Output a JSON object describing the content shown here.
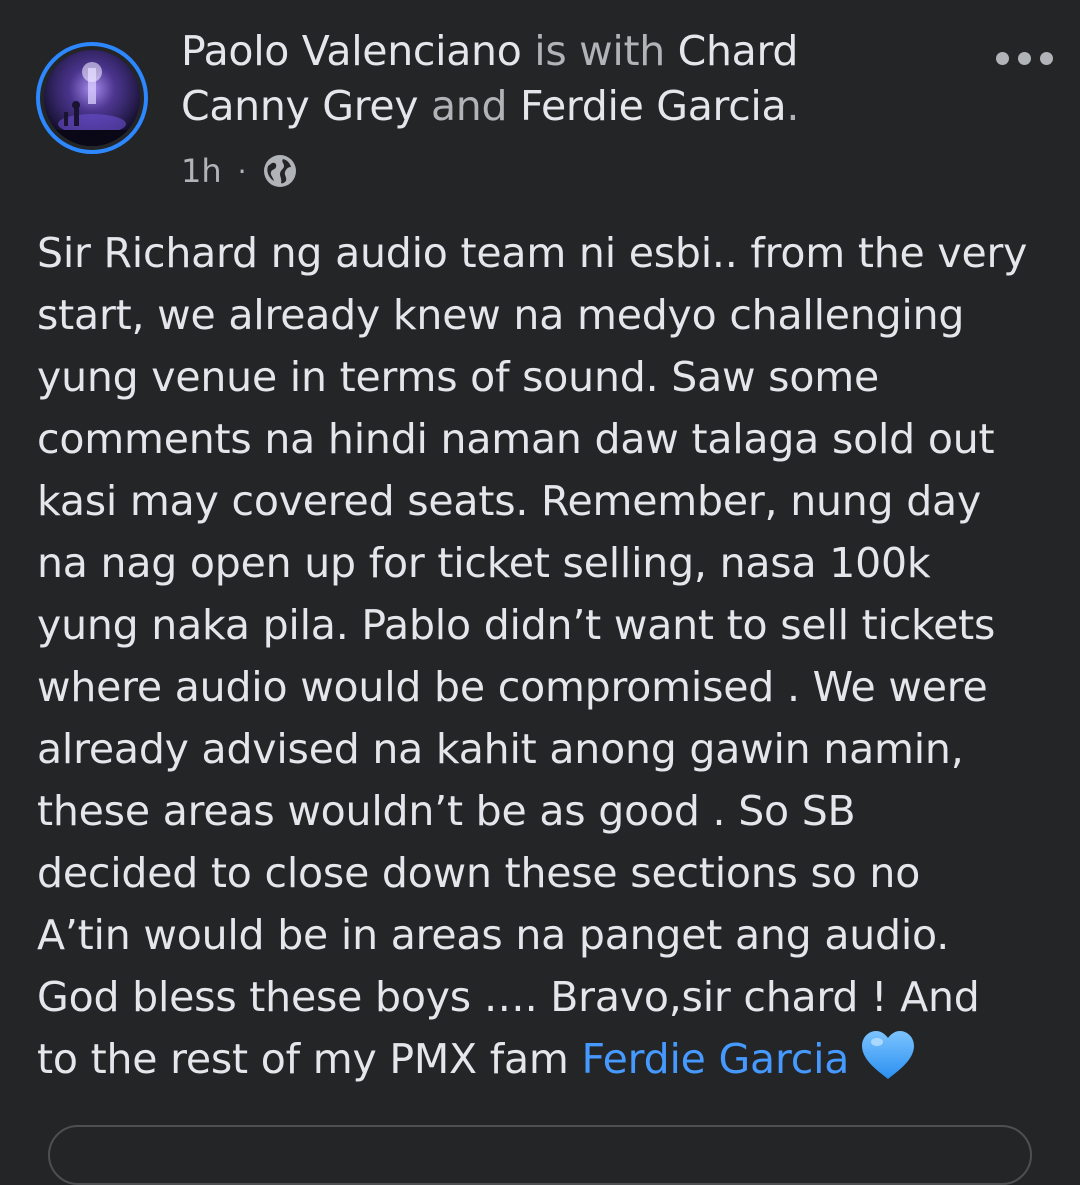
{
  "post": {
    "author": "Paolo Valenciano",
    "with_text": "is with",
    "tagged_1_line1": "Chard",
    "tagged_1_line2": "Canny Grey",
    "and_text": "and",
    "tagged_2": "Ferdie Garcia",
    "period": ".",
    "timestamp": "1h",
    "separator": "·",
    "privacy_icon": "globe-icon",
    "more_icon": "more-horizontal-icon",
    "accent_color": "#2d88ff",
    "mention_color": "#4599ff",
    "body_lines": [
      "Sir Richard ng audio team ni esbi.. from the very",
      "start, we already knew na medyo challenging",
      "yung venue in terms of sound. Saw some",
      "comments na hindi naman daw talaga sold out",
      "kasi may covered seats. Remember, nung day",
      "na nag open up for ticket selling, nasa 100k",
      "yung naka pila. Pablo didn’t want to sell tickets",
      "where audio would be compromised . We were",
      "already advised na kahit anong gawin namin,",
      "these areas wouldn’t be as good . So SB",
      "decided to close down these sections so no",
      "A’tin would be in areas na panget ang audio.",
      "God bless these boys …. Bravo,sir chard ! And"
    ],
    "last_line_prefix": "to the rest of my PMX fam",
    "last_line_mention": "Ferdie Garcia",
    "last_line_emoji": "blue-heart-icon"
  }
}
